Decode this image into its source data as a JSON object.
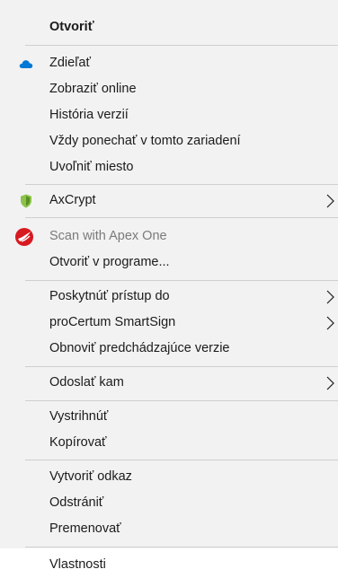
{
  "menu": {
    "open": "Otvoriť",
    "share": "Zdieľať",
    "view_online": "Zobraziť online",
    "version_history": "História verzií",
    "keep_on_device": "Vždy ponechať v tomto zariadení",
    "free_up_space": "Uvoľniť miesto",
    "axcrypt": "AxCrypt",
    "scan_apex": "Scan with Apex One",
    "open_with": "Otvoriť v programe...",
    "give_access": "Poskytnúť prístup do",
    "procertum": "proCertum SmartSign",
    "restore_versions": "Obnoviť predchádzajúce verzie",
    "send_to": "Odoslať kam",
    "cut": "Vystrihnúť",
    "copy": "Kopírovať",
    "create_shortcut": "Vytvoriť odkaz",
    "delete": "Odstrániť",
    "rename": "Premenovať",
    "properties": "Vlastnosti"
  },
  "icons": {
    "share": "onedrive-cloud-icon",
    "axcrypt": "axcrypt-shield-icon",
    "scan_apex": "apex-one-scan-icon",
    "submenu": "chevron-right-icon"
  },
  "colors": {
    "onedrive_blue": "#0078d4",
    "axcrypt_green": "#8bc34a",
    "apex_red": "#d71920"
  }
}
